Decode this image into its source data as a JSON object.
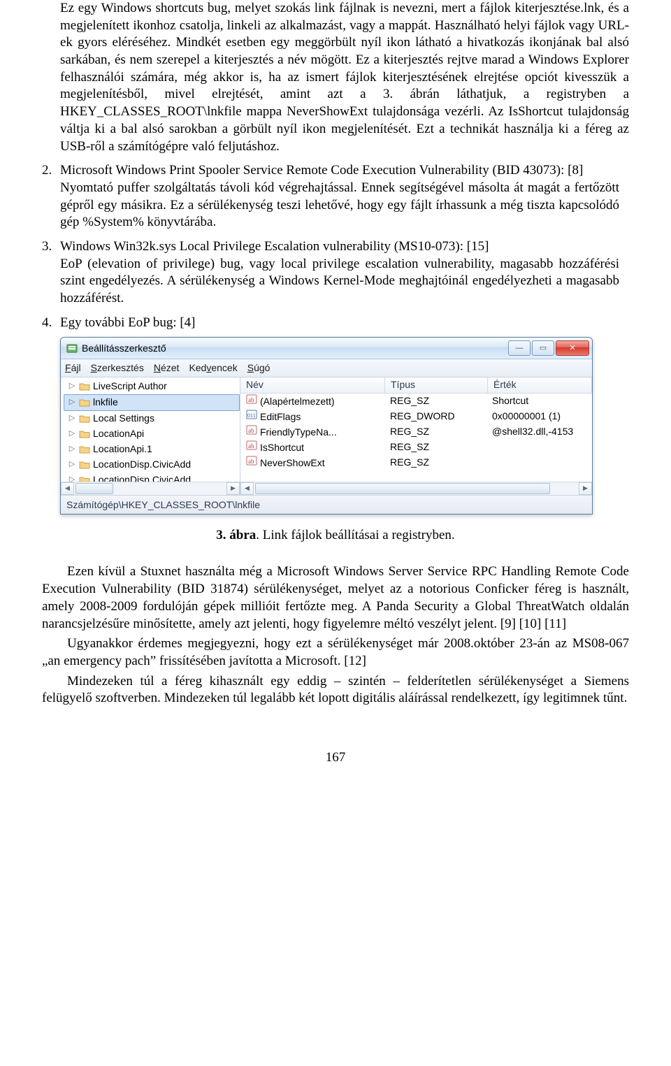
{
  "para1": "Ez egy Windows shortcuts bug, melyet szokás link fájlnak is nevezni, mert a fájlok kiterjesztése.lnk, és a megjelenített ikonhoz csatolja, linkeli az alkalmazást, vagy a mappát. Használható helyi fájlok vagy URL-ek gyors eléréséhez. Mindkét esetben egy meggörbült nyíl ikon látható a hivatkozás ikonjának bal alsó sarkában, és nem szerepel a kiterjesztés a név mögött. Ez a kiterjesztés rejtve marad a Windows Explorer felhasználói számára, még akkor is, ha az ismert fájlok kiterjesztésének elrejtése opciót kivesszük a megjelenítésből, mivel elrejtését, amint azt a 3. ábrán láthatjuk, a registryben a HKEY_CLASSES_ROOT\\lnkfile mappa NeverShowExt tulajdonsága vezérli. Az IsShortcut tulajdonság váltja ki a bal alsó sarokban a görbült nyíl ikon megjelenítését. Ezt a technikát használja ki a féreg az USB-ről a számítógépre való feljutáshoz.",
  "item2_num": "2.",
  "item2_line1": "Microsoft Windows Print Spooler Service Remote Code Execution Vulnerability (BID 43073): [8]",
  "item2_line2": "Nyomtató puffer szolgáltatás távoli kód végrehajtással. Ennek segítségével másolta át magát a fertőzött gépről egy másikra. Ez a sérülékenység teszi lehetővé, hogy egy fájlt írhassunk a még tiszta kapcsolódó gép %System% könyvtárába.",
  "item3_num": "3.",
  "item3_line1": "Windows Win32k.sys Local Privilege Escalation vulnerability (MS10-073): [15]",
  "item3_line2": "EoP (elevation of privilege) bug, vagy local privilege escalation vulnerability, magasabb hozzáférési szint engedélyezés. A sérülékenység a Windows Kernel-Mode meghajtóinál engedélyezheti a magasabb hozzáférést.",
  "item4_num": "4.",
  "item4_line1": "Egy további EoP bug: [4]",
  "fig_caption_bold": "3. ábra",
  "fig_caption_rest": ". Link fájlok beállításai a registryben.",
  "para_after1": "Ezen kívül a Stuxnet használta még a Microsoft Windows Server Service RPC Handling Remote Code Execution Vulnerability (BID 31874) sérülékenységet, melyet az a notorious Conficker féreg is használt, amely 2008-2009 fordulóján gépek millióit fertőzte meg. A Panda Security a Global ThreatWatch oldalán narancsjelzésűre minősítette, amely azt jelenti, hogy figyelemre méltó veszélyt jelent. [9] [10] [11]",
  "para_after2": "Ugyanakkor érdemes megjegyezni, hogy ezt a sérülékenységet már 2008.október 23-án az MS08-067 „an emergency pach” frissítésében javította a Microsoft. [12]",
  "para_after3": "Mindezeken túl a féreg kihasznált egy eddig – szintén – felderítetlen sérülékenységet a Siemens felügyelő szoftverben. Mindezeken túl legalább két lopott digitális aláírással rendelkezett, így legitimnek tűnt.",
  "page_number": "167",
  "regedit": {
    "title": "Beállításszerkesztő",
    "menu": {
      "file": "Fájl",
      "edit": "Szerkesztés",
      "view": "Nézet",
      "fav": "Kedvencek",
      "help": "Súgó",
      "file_u": "F",
      "edit_u": "S",
      "view_u": "N",
      "fav_u": "v",
      "help_u": "S"
    },
    "tree": [
      {
        "label": "LiveScript Author"
      },
      {
        "label": "lnkfile",
        "selected": true
      },
      {
        "label": "Local Settings"
      },
      {
        "label": "LocationApi"
      },
      {
        "label": "LocationApi.1"
      },
      {
        "label": "LocationDisp.CivicAdd"
      },
      {
        "label": "LocationDisp.CivicAdd"
      }
    ],
    "cols": {
      "name": "Név",
      "type": "Típus",
      "value": "Érték"
    },
    "rows": [
      {
        "icon": "str",
        "name": "(Alapértelmezett)",
        "type": "REG_SZ",
        "value": "Shortcut"
      },
      {
        "icon": "bin",
        "name": "EditFlags",
        "type": "REG_DWORD",
        "value": "0x00000001 (1)"
      },
      {
        "icon": "str",
        "name": "FriendlyTypeNa...",
        "type": "REG_SZ",
        "value": "@shell32.dll,-4153"
      },
      {
        "icon": "str",
        "name": "IsShortcut",
        "type": "REG_SZ",
        "value": ""
      },
      {
        "icon": "str",
        "name": "NeverShowExt",
        "type": "REG_SZ",
        "value": ""
      }
    ],
    "status": "Számítógép\\HKEY_CLASSES_ROOT\\lnkfile"
  }
}
